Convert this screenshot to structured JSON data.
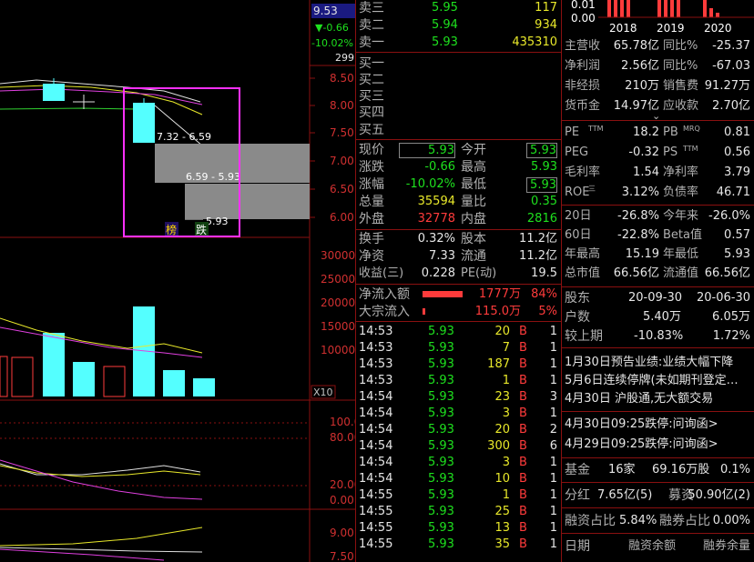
{
  "header": {
    "price": "9.53",
    "change": "▼-0.66",
    "pct": "-10.02%",
    "vol": "299"
  },
  "chart": {
    "price_ticks": [
      "8.50",
      "8.00",
      "7.50",
      "7.00",
      "6.50",
      "6.00"
    ],
    "vol_ticks": [
      "30000",
      "25000",
      "20000",
      "15000",
      "10000"
    ],
    "vol_unit": "X10",
    "ind1_ticks": [
      "100.00",
      "80.00",
      "20.00",
      "0.00"
    ],
    "ind2_ticks": [
      "9.00",
      "7.50"
    ],
    "gap_labels": [
      "7.32 - 6.59",
      "6.59 - 5.93",
      "5.93"
    ],
    "badges": [
      "榜",
      "跌"
    ]
  },
  "orderbook": {
    "sell": [
      {
        "label": "卖三",
        "price": "5.95",
        "vol": "117"
      },
      {
        "label": "卖二",
        "price": "5.94",
        "vol": "934"
      },
      {
        "label": "卖一",
        "price": "5.93",
        "vol": "435310"
      }
    ],
    "buy": [
      "买一",
      "买二",
      "买三",
      "买四",
      "买五"
    ]
  },
  "quote": [
    {
      "l1": "现价",
      "v1": "5.93",
      "l2": "今开",
      "v2": "5.93"
    },
    {
      "l1": "涨跌",
      "v1": "-0.66",
      "l2": "最高",
      "v2": "5.93"
    },
    {
      "l1": "涨幅",
      "v1": "-10.02%",
      "l2": "最低",
      "v2": "5.93"
    },
    {
      "l1": "总量",
      "v1": "35594",
      "l2": "量比",
      "v2": "0.35"
    },
    {
      "l1": "外盘",
      "v1": "32778",
      "l2": "内盘",
      "v2": "2816"
    }
  ],
  "stats": [
    {
      "l1": "换手",
      "v1": "0.32%",
      "l2": "股本",
      "v2": "11.2亿"
    },
    {
      "l1": "净资",
      "v1": "7.33",
      "l2": "流通",
      "v2": "11.2亿"
    },
    {
      "l1": "收益(三)",
      "v1": "0.228",
      "l2": "PE(动)",
      "v2": "19.5"
    }
  ],
  "flow": [
    {
      "label": "净流入额",
      "value": "1777万",
      "pct": "84%"
    },
    {
      "label": "大宗流入",
      "value": "115.0万",
      "pct": "5%"
    }
  ],
  "ticks": [
    {
      "t": "14:53",
      "p": "5.93",
      "v": "20",
      "s": "B",
      "n": "1"
    },
    {
      "t": "14:53",
      "p": "5.93",
      "v": "7",
      "s": "B",
      "n": "1"
    },
    {
      "t": "14:53",
      "p": "5.93",
      "v": "187",
      "s": "B",
      "n": "1"
    },
    {
      "t": "14:53",
      "p": "5.93",
      "v": "1",
      "s": "B",
      "n": "1"
    },
    {
      "t": "14:54",
      "p": "5.93",
      "v": "23",
      "s": "B",
      "n": "3"
    },
    {
      "t": "14:54",
      "p": "5.93",
      "v": "3",
      "s": "B",
      "n": "1"
    },
    {
      "t": "14:54",
      "p": "5.93",
      "v": "20",
      "s": "B",
      "n": "2"
    },
    {
      "t": "14:54",
      "p": "5.93",
      "v": "300",
      "s": "B",
      "n": "6"
    },
    {
      "t": "14:54",
      "p": "5.93",
      "v": "3",
      "s": "B",
      "n": "1"
    },
    {
      "t": "14:54",
      "p": "5.93",
      "v": "10",
      "s": "B",
      "n": "1"
    },
    {
      "t": "14:55",
      "p": "5.93",
      "v": "1",
      "s": "B",
      "n": "1"
    },
    {
      "t": "14:55",
      "p": "5.93",
      "v": "25",
      "s": "B",
      "n": "1"
    },
    {
      "t": "14:55",
      "p": "5.93",
      "v": "13",
      "s": "B",
      "n": "1"
    },
    {
      "t": "14:55",
      "p": "5.93",
      "v": "35",
      "s": "B",
      "n": "1"
    }
  ],
  "fundamentals": {
    "years": [
      "2018",
      "2019",
      "2020"
    ],
    "mini_ticks": [
      "0.01",
      "0.00"
    ],
    "rows": [
      {
        "l1": "主营收",
        "v1": "65.78亿",
        "l2": "同比%",
        "v2": "-25.37"
      },
      {
        "l1": "净利润",
        "v1": "2.56亿",
        "l2": "同比%",
        "v2": "-67.03"
      },
      {
        "l1": "非经损",
        "v1": "210万",
        "l2": "销售费",
        "v2": "91.27万"
      },
      {
        "l1": "货币金",
        "v1": "14.97亿",
        "l2": "应收款",
        "v2": "2.70亿"
      }
    ],
    "val": [
      {
        "l1": "PE",
        "s1": "TTM",
        "v1": "18.2",
        "l2": "PB",
        "s2": "MRQ",
        "v2": "0.81"
      },
      {
        "l1": "PEG",
        "s1": "",
        "v1": "-0.32",
        "l2": "PS",
        "s2": "TTM",
        "v2": "0.56"
      },
      {
        "l1": "毛利率",
        "s1": "",
        "v1": "1.54",
        "l2": "净利率",
        "s2": "",
        "v2": "3.79"
      },
      {
        "l1": "ROE",
        "s1": "三",
        "v1": "3.12%",
        "l2": "负债率",
        "s2": "",
        "v2": "46.71"
      }
    ],
    "perf": [
      {
        "l1": "20日",
        "v1": "-26.8%",
        "l2": "今年来",
        "v2": "-26.0%"
      },
      {
        "l1": "60日",
        "v1": "-22.8%",
        "l2": "Beta值",
        "v2": "0.57"
      },
      {
        "l1": "年最高",
        "v1": "15.19",
        "l2": "年最低",
        "v2": "5.93"
      },
      {
        "l1": "总市值",
        "v1": "66.56亿",
        "l2": "流通值",
        "v2": "66.56亿"
      }
    ],
    "holders": {
      "head": [
        "股东",
        "20-09-30",
        "20-06-30"
      ],
      "hu": [
        "户数",
        "5.40万",
        "6.05万"
      ],
      "cmp": [
        "较上期",
        "-10.83%",
        "1.72%"
      ]
    },
    "news": [
      "1月30日预告业绩:业绩大幅下降",
      "5月6日连续停牌(未如期刊登定…",
      "4月30日 沪股通,无大额交易"
    ],
    "alerts": [
      "4月30日09:25跌停:问询函>",
      "4月29日09:25跌停:问询函>"
    ],
    "fund": {
      "l": "基金",
      "n": "16家",
      "v": "69.16万股",
      "p": "0.1%"
    },
    "div": {
      "l": "分红",
      "v": "7.65亿(5)",
      "l2": "募资",
      "v2": "50.90亿(2)"
    },
    "margin": {
      "l": "融资占比",
      "v": "5.84%",
      "l2": "融券占比",
      "v2": "0.00%"
    },
    "margin_head": [
      "日期",
      "融资余额",
      "融券余量"
    ]
  }
}
